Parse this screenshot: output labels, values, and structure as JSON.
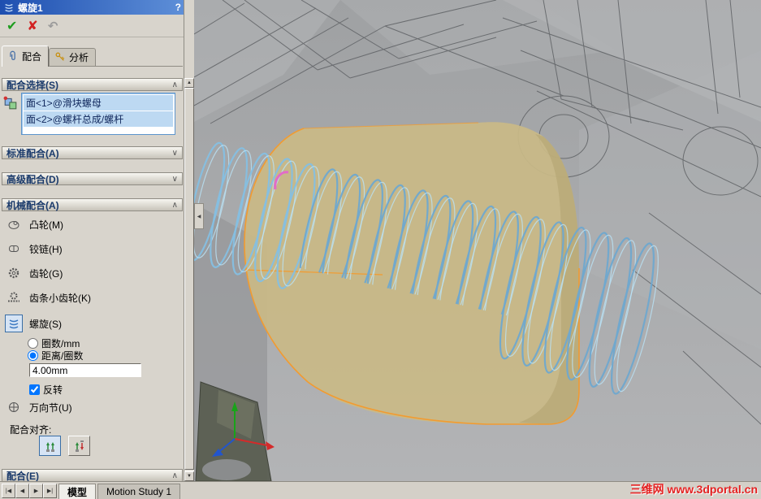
{
  "icons": {
    "help": "?",
    "ok": "✔",
    "cancel": "✘",
    "undo": "↶",
    "chevron_up": "∧",
    "chevron_down": "∨",
    "scroll_up": "▲",
    "scroll_down": "▼",
    "collapse_left": "◀"
  },
  "panel": {
    "title": "螺旋1",
    "tab_mate": "配合",
    "tab_analysis": "分析",
    "mate_selections": {
      "header": "配合选择(S)",
      "items": [
        "面<1>@滑块螺母",
        "面<2>@螺杆总成/螺杆"
      ]
    },
    "standard_header": "标准配合(A)",
    "advanced_header": "高级配合(D)",
    "mechanical": {
      "header": "机械配合(A)",
      "cam": "凸轮(M)",
      "hinge": "铰链(H)",
      "gear": "齿轮(G)",
      "rack_pinion": "齿条小齿轮(K)",
      "screw": "螺旋(S)",
      "rev_per_mm": "圈数/mm",
      "dist_per_rev": "距离/圈数",
      "dist_selected": true,
      "distance_value": "4.00mm",
      "reverse": "反转",
      "reverse_checked": true,
      "universal_joint": "万向节(U)",
      "mate_alignment": "配合对齐:"
    },
    "mates_header": "配合(E)"
  },
  "statusbar": {
    "nav": [
      "|◀",
      "◀",
      "▶",
      "▶|"
    ],
    "model_tab": "模型",
    "motion_tab": "Motion Study 1"
  },
  "watermark": "三维网 www.3dportal.cn",
  "colors": {
    "titlebar_blue": "#1E4FB0",
    "selection_blue": "#BDD9F2",
    "highlight_orange": "#F29B30",
    "helix_blue": "#6FA8CF",
    "nut_tan": "#C9B987"
  }
}
